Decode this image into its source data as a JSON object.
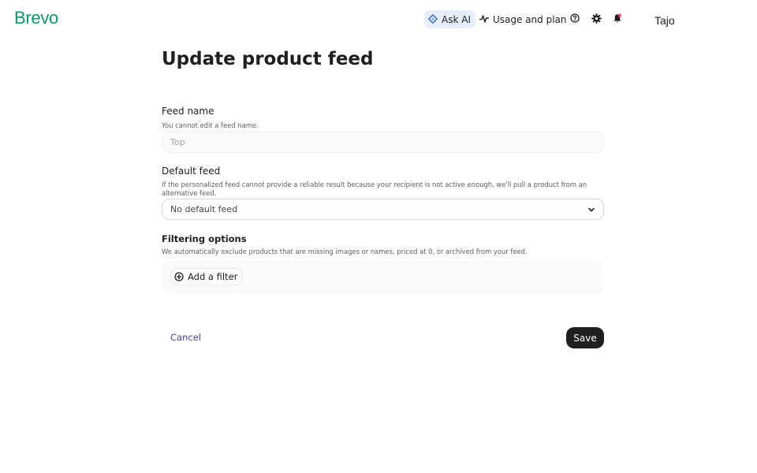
{
  "header": {
    "logo": "Brevo",
    "ask_ai": "Ask AI",
    "usage": "Usage and plan",
    "user": "Tajo"
  },
  "page": {
    "title": "Update product feed"
  },
  "feed_name": {
    "label": "Feed name",
    "help": "You cannot edit a feed name.",
    "placeholder": "Top"
  },
  "default_feed": {
    "label": "Default feed",
    "help": "If the personalized feed cannot provide a reliable result because your recipient is not active enough, we'll pull a product from an alternative feed.",
    "selected": "No default feed"
  },
  "filtering": {
    "title": "Filtering options",
    "help": "We automatically exclude products that are missing images or names, priced at 0, or archived from your feed.",
    "add_filter": "Add a filter"
  },
  "actions": {
    "cancel": "Cancel",
    "save": "Save"
  },
  "colors": {
    "brand": "#0b996e",
    "link": "#4b3fa3",
    "primary_button": "#1f1f1f",
    "ask_ai_bg": "#e8effc"
  },
  "icons": {
    "ask_ai": "sparkle-diamond-icon",
    "usage": "activity-pulse-icon",
    "help": "help-circle-icon",
    "settings": "gear-icon",
    "notifications": "bell-icon",
    "dropdown": "chevron-down-icon",
    "add": "plus-circle-icon"
  }
}
